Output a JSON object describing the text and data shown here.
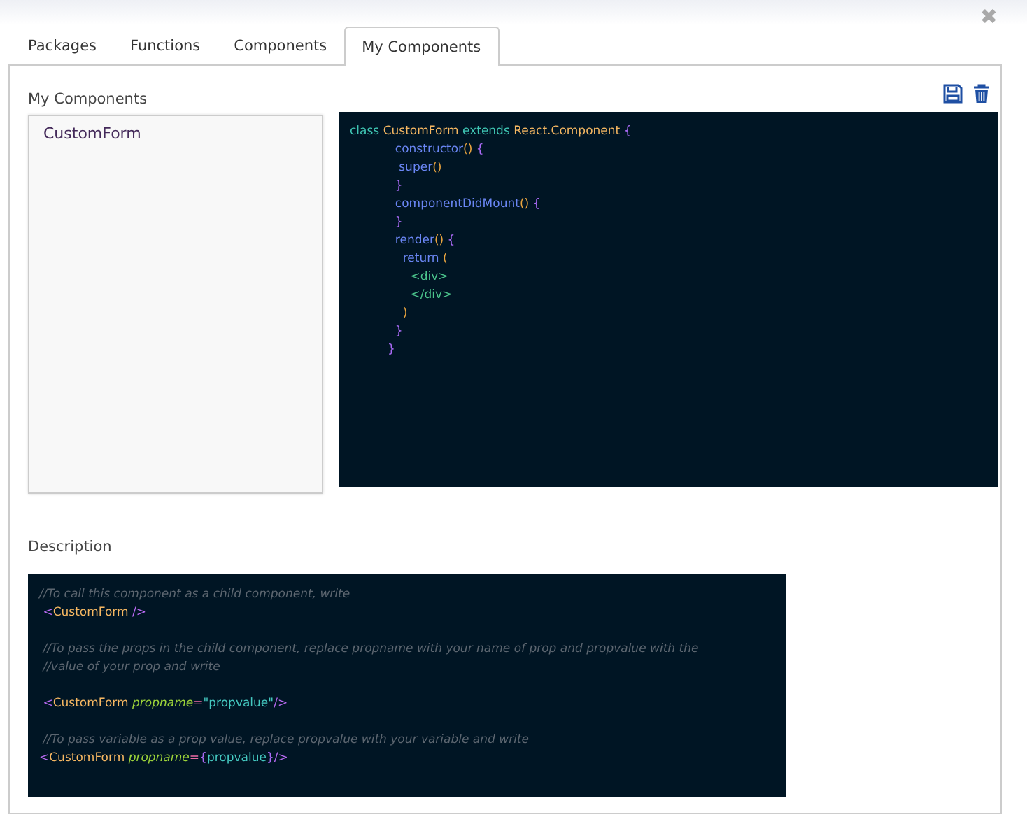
{
  "tabs": [
    {
      "label": "Packages",
      "selected": false
    },
    {
      "label": "Functions",
      "selected": false
    },
    {
      "label": "Components",
      "selected": false
    },
    {
      "label": "My Components",
      "selected": true
    }
  ],
  "close": "✖",
  "section_title": "My Components",
  "components": [
    {
      "label": "CustomForm",
      "selected": false
    }
  ],
  "code_lines": [
    [
      {
        "kind": "keyword",
        "text": "class "
      },
      {
        "kind": "name",
        "text": "CustomForm "
      },
      {
        "kind": "keyword",
        "text": "extends "
      },
      {
        "kind": "name",
        "text": "React.Component "
      },
      {
        "kind": "brace",
        "text": "{"
      }
    ],
    [
      {
        "kind": "func",
        "text": "            constructor"
      },
      {
        "kind": "paren",
        "text": "()"
      },
      {
        "kind": "brace",
        "text": " {"
      }
    ],
    [
      {
        "kind": "func",
        "text": "             super"
      },
      {
        "kind": "paren",
        "text": "()"
      }
    ],
    [
      {
        "kind": "brace",
        "text": "            }"
      }
    ],
    [
      {
        "kind": "func",
        "text": "            componentDidMount"
      },
      {
        "kind": "paren",
        "text": "()"
      },
      {
        "kind": "brace",
        "text": " {"
      }
    ],
    [
      {
        "kind": "brace",
        "text": "            }"
      }
    ],
    [
      {
        "kind": "func",
        "text": "            render"
      },
      {
        "kind": "paren",
        "text": "()"
      },
      {
        "kind": "brace",
        "text": " {"
      }
    ],
    [
      {
        "kind": "func",
        "text": "              return "
      },
      {
        "kind": "paren",
        "text": "("
      }
    ],
    [
      {
        "kind": "tag",
        "text": "                <div>"
      }
    ],
    [
      {
        "kind": "tag",
        "text": "                </div>"
      }
    ],
    [
      {
        "kind": "paren",
        "text": "              )"
      }
    ],
    [
      {
        "kind": "brace",
        "text": "            }"
      }
    ],
    [
      {
        "kind": "brace",
        "text": "          }"
      }
    ]
  ],
  "description_title": "Description",
  "description_blocks": [
    [
      [
        {
          "kind": "comment",
          "text": "//To call this component as a child component, write"
        }
      ],
      [
        {
          "kind": "angle",
          "text": " <"
        },
        {
          "kind": "name",
          "text": "CustomForm "
        },
        {
          "kind": "angle",
          "text": "/>"
        }
      ]
    ],
    [
      [
        {
          "kind": "comment",
          "text": " //To pass the props in the child component, replace propname with your name of prop and propvalue with the"
        }
      ],
      [
        {
          "kind": "comment",
          "text": " //value of your prop and write"
        }
      ]
    ],
    [
      [
        {
          "kind": "angle",
          "text": " <"
        },
        {
          "kind": "name",
          "text": "CustomForm "
        },
        {
          "kind": "attr",
          "text": "propname"
        },
        {
          "kind": "eq",
          "text": "="
        },
        {
          "kind": "string",
          "text": "\"propvalue\""
        },
        {
          "kind": "angle",
          "text": "/>"
        }
      ]
    ],
    [
      [
        {
          "kind": "comment",
          "text": " //To pass variable as a prop value, replace propvalue with your variable and write"
        }
      ],
      [
        {
          "kind": "angle",
          "text": "<"
        },
        {
          "kind": "name",
          "text": "CustomForm "
        },
        {
          "kind": "attr",
          "text": "propname"
        },
        {
          "kind": "eq",
          "text": "="
        },
        {
          "kind": "brace",
          "text": "{"
        },
        {
          "kind": "string",
          "text": "propvalue"
        },
        {
          "kind": "brace",
          "text": "}"
        },
        {
          "kind": "angle",
          "text": "/>"
        }
      ]
    ]
  ]
}
